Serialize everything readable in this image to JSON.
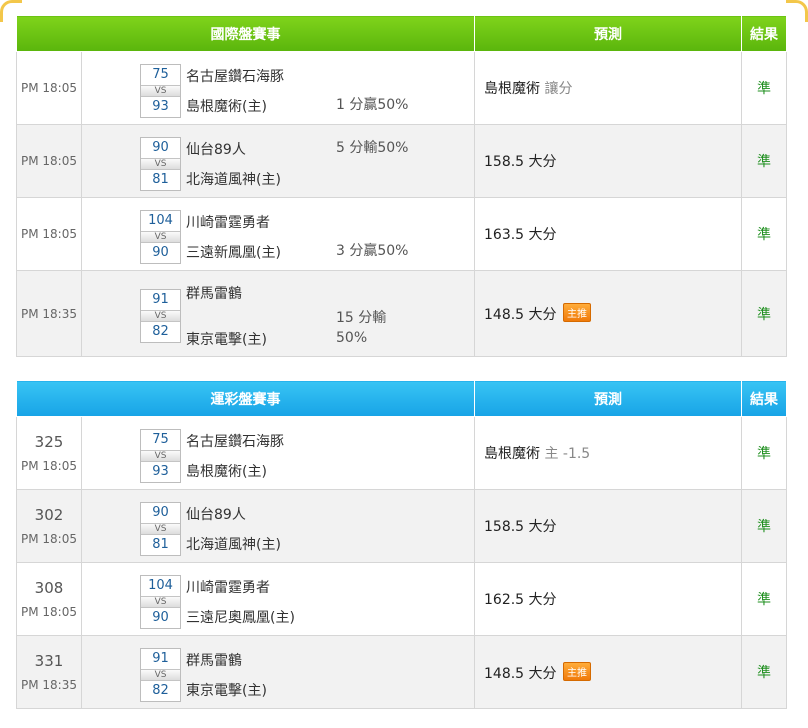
{
  "intl": {
    "header": {
      "title": "國際盤賽事",
      "prediction": "預測",
      "result": "結果"
    },
    "rows": [
      {
        "time": "PM 18:05",
        "score_away": "75",
        "score_home": "93",
        "team_away": "名古屋鑽石海豚",
        "team_home": "島根魔術(主)",
        "line": "1 分贏50%",
        "prediction": "島根魔術",
        "prediction_sub": "讓分",
        "badge": "",
        "result": "準"
      },
      {
        "time": "PM 18:05",
        "score_away": "90",
        "score_home": "81",
        "team_away": "仙台89人",
        "team_home": "北海道風神(主)",
        "line": "5 分輸50%",
        "prediction": "158.5 大分",
        "prediction_sub": "",
        "badge": "",
        "result": "準"
      },
      {
        "time": "PM 18:05",
        "score_away": "104",
        "score_home": "90",
        "team_away": "川崎雷霆勇者",
        "team_home": "三遠新鳳凰(主)",
        "line": "3 分贏50%",
        "prediction": "163.5 大分",
        "prediction_sub": "",
        "badge": "",
        "result": "準"
      },
      {
        "time": "PM 18:35",
        "score_away": "91",
        "score_home": "82",
        "team_away": "群馬雷鶴",
        "team_home": "東京電擊(主)",
        "line_1": "15 分輸",
        "line_2": "50%",
        "prediction": "148.5 大分",
        "prediction_sub": "",
        "badge": "主推",
        "result": "準"
      }
    ]
  },
  "sports": {
    "header": {
      "title": "運彩盤賽事",
      "prediction": "預測",
      "result": "結果"
    },
    "rows": [
      {
        "num": "325",
        "time": "PM 18:05",
        "score_away": "75",
        "score_home": "93",
        "team_away": "名古屋鑽石海豚",
        "team_home": "島根魔術(主)",
        "prediction": "島根魔術",
        "prediction_sub": "主 -1.5",
        "badge": "",
        "result": "準"
      },
      {
        "num": "302",
        "time": "PM 18:05",
        "score_away": "90",
        "score_home": "81",
        "team_away": "仙台89人",
        "team_home": "北海道風神(主)",
        "prediction": "158.5 大分",
        "prediction_sub": "",
        "badge": "",
        "result": "準"
      },
      {
        "num": "308",
        "time": "PM 18:05",
        "score_away": "104",
        "score_home": "90",
        "team_away": "川崎雷霆勇者",
        "team_home": "三遠尼奧鳳凰(主)",
        "prediction": "162.5 大分",
        "prediction_sub": "",
        "badge": "",
        "result": "準"
      },
      {
        "num": "331",
        "time": "PM 18:35",
        "score_away": "91",
        "score_home": "82",
        "team_away": "群馬雷鶴",
        "team_home": "東京電擊(主)",
        "prediction": "148.5 大分",
        "prediction_sub": "",
        "badge": "主推",
        "result": "準"
      }
    ]
  },
  "vs_label": "VS"
}
